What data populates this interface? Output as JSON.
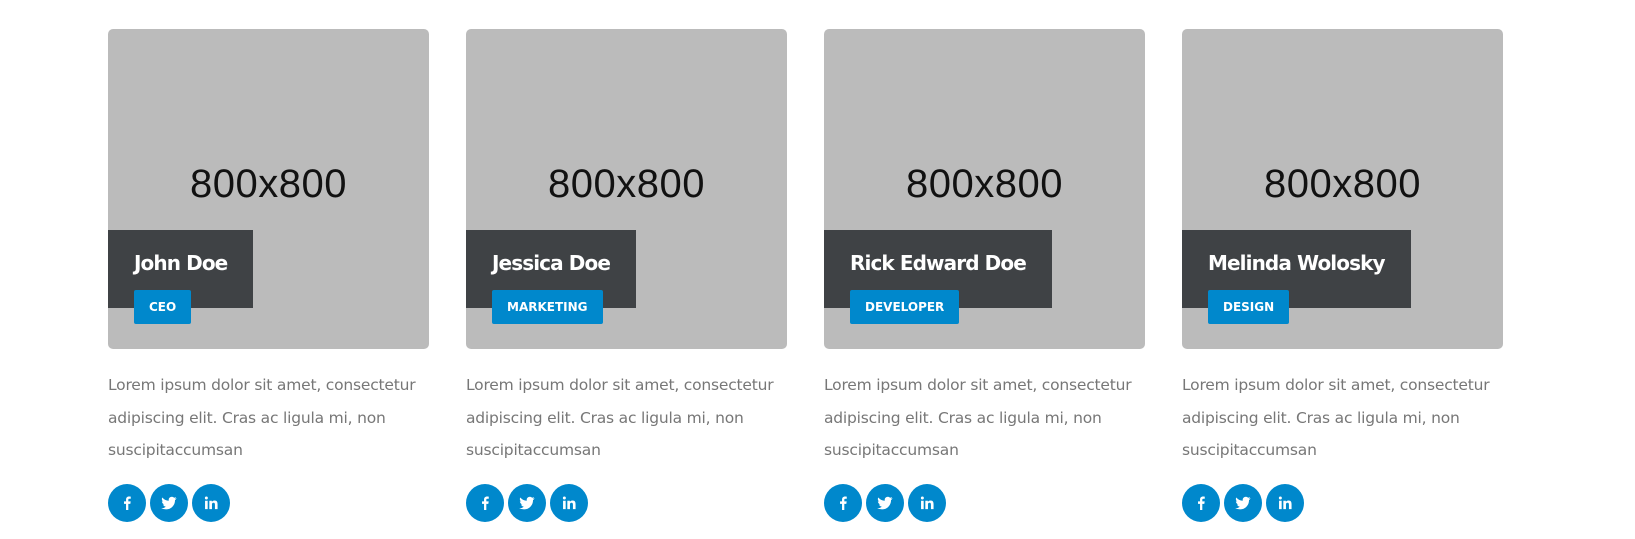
{
  "team": {
    "members": [
      {
        "photo_text": "800x800",
        "name": "John Doe",
        "role": "CEO",
        "bio": "Lorem ipsum dolor sit amet, consectetur adipiscing elit. Cras ac ligula mi, non suscipitaccumsan"
      },
      {
        "photo_text": "800x800",
        "name": "Jessica Doe",
        "role": "MARKETING",
        "bio": "Lorem ipsum dolor sit amet, consectetur adipiscing elit. Cras ac ligula mi, non suscipitaccumsan"
      },
      {
        "photo_text": "800x800",
        "name": "Rick Edward Doe",
        "role": "DEVELOPER",
        "bio": "Lorem ipsum dolor sit amet, consectetur adipiscing elit. Cras ac ligula mi, non suscipitaccumsan"
      },
      {
        "photo_text": "800x800",
        "name": "Melinda Wolosky",
        "role": "DESIGN",
        "bio": "Lorem ipsum dolor sit amet, consectetur adipiscing elit. Cras ac ligula mi, non suscipitaccumsan"
      }
    ],
    "social_icons": [
      "facebook-icon",
      "twitter-icon",
      "linkedin-icon"
    ]
  },
  "colors": {
    "accent": "#0088cc",
    "name_box": "#3f4245",
    "photo_placeholder": "#bbbbbb",
    "body_text": "#777777"
  }
}
